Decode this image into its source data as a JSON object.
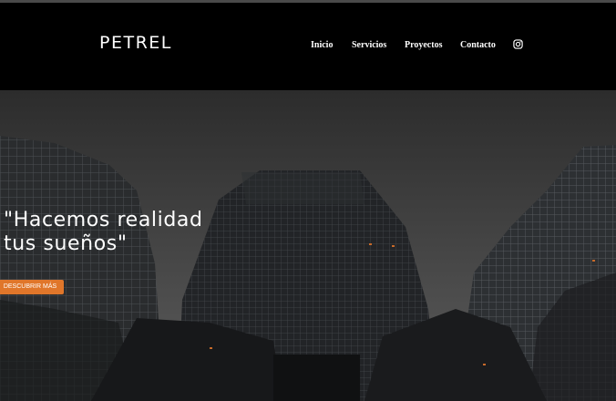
{
  "site": {
    "logo_text": "PETREL"
  },
  "nav": {
    "items": [
      {
        "label": "Inicio"
      },
      {
        "label": "Servicios"
      },
      {
        "label": "Proyectos"
      },
      {
        "label": "Contacto"
      }
    ],
    "social_icon": "instagram-icon"
  },
  "hero": {
    "headline": "\"Hacemos realidad\ntus sueños\"",
    "cta_label": "DESCUBRIR MÁS",
    "background": "dark-skyscrapers-photo"
  },
  "colors": {
    "accent": "#e0762a",
    "header_bg": "#000000",
    "text": "#ffffff"
  }
}
